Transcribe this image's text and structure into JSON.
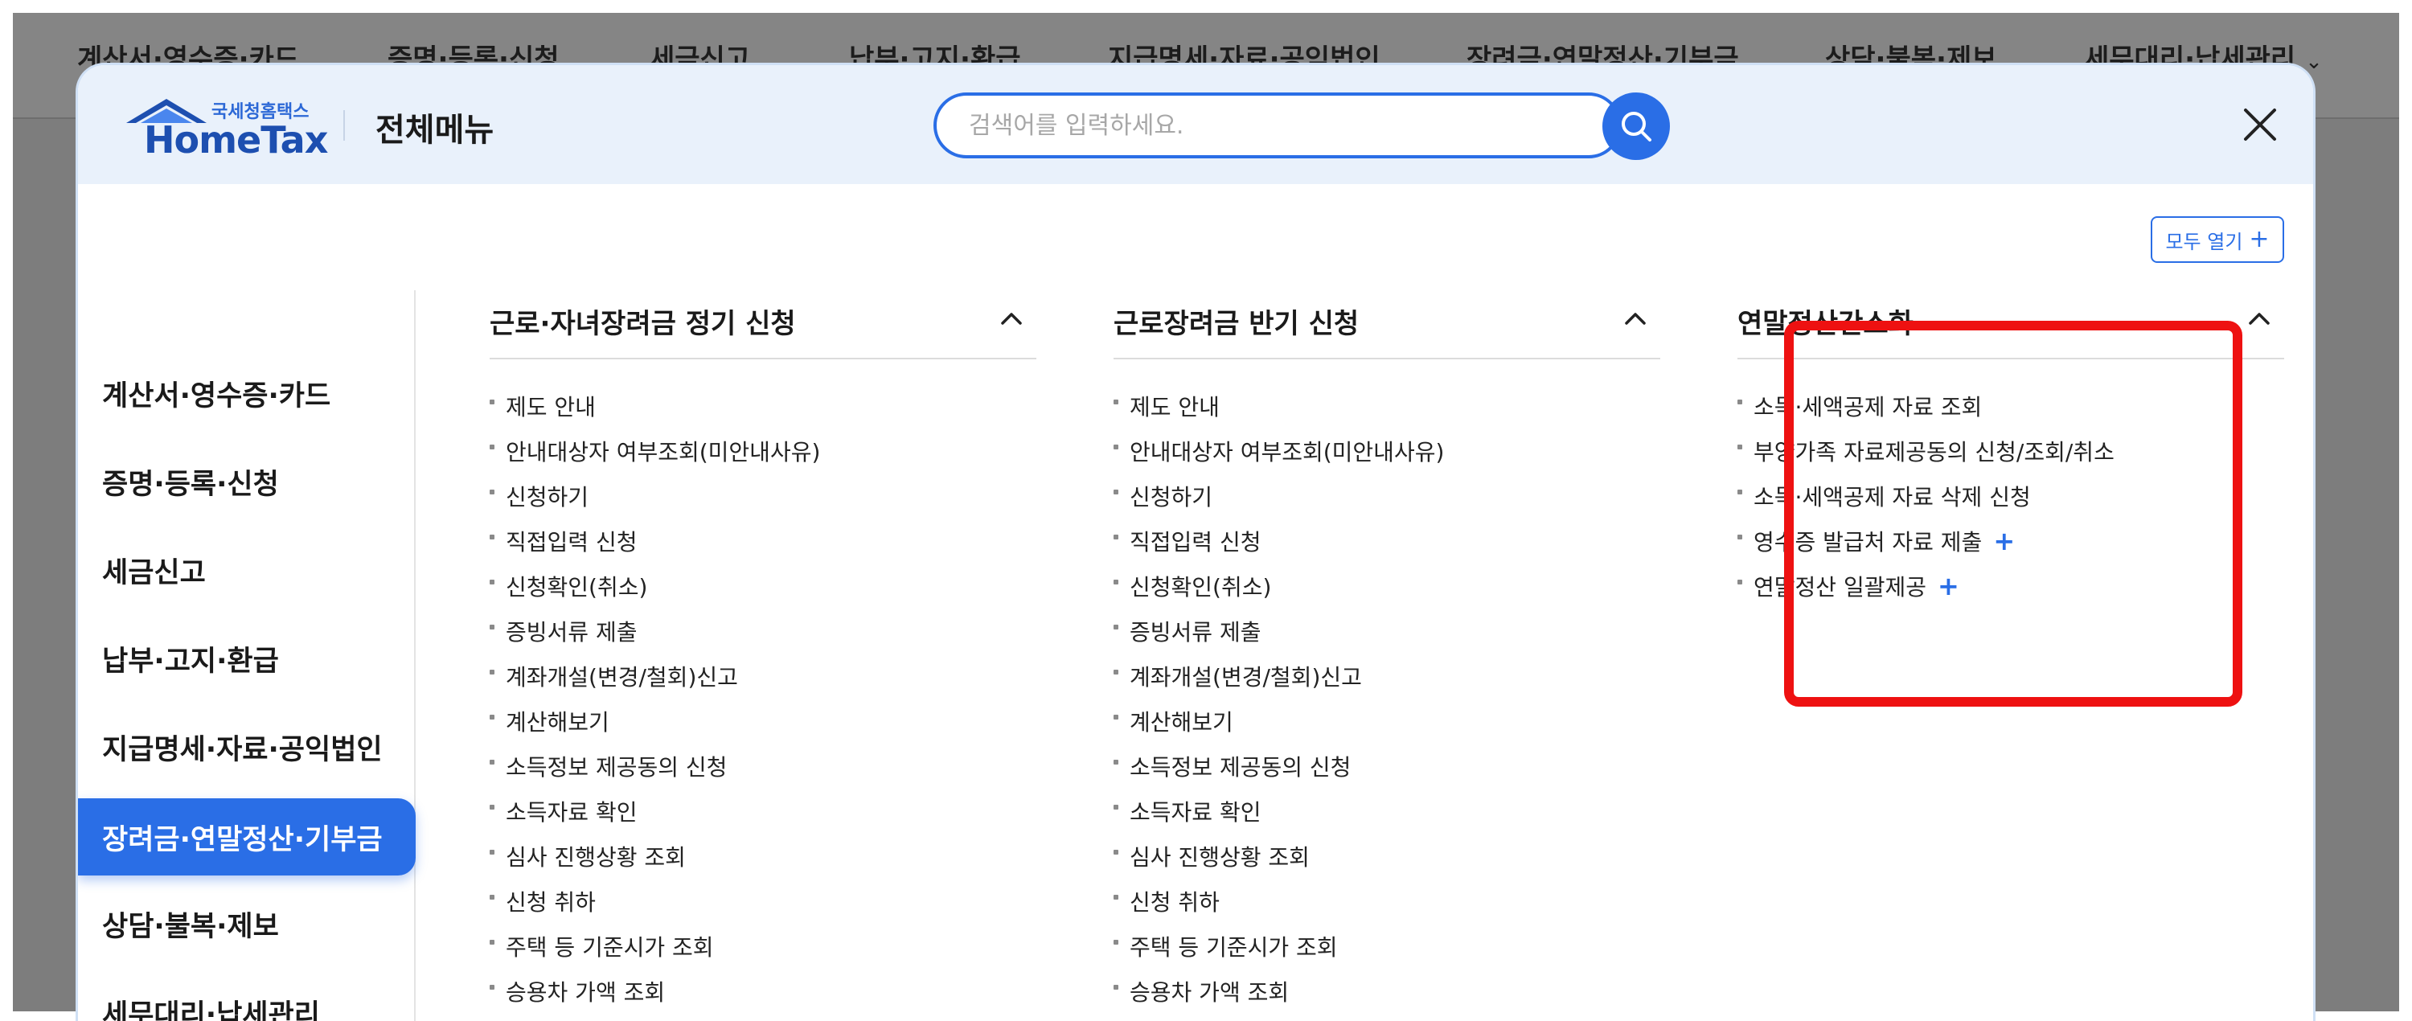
{
  "top_nav": {
    "items": [
      {
        "label": "계산서·영수증·카드"
      },
      {
        "label": "증명·등록·신청"
      },
      {
        "label": "세금신고"
      },
      {
        "label": "납부·고지·환급"
      },
      {
        "label": "지급명세·자료·공익법인"
      },
      {
        "label": "장려금·연말정산·기부금"
      },
      {
        "label": "상담·불복·제보"
      },
      {
        "label": "세무대리·납세관리"
      }
    ],
    "chevron": "⌄"
  },
  "modal": {
    "logo": {
      "small_text": "국세청홈택스",
      "big_text": "HomeTax"
    },
    "title": "전체메뉴",
    "search": {
      "placeholder": "검색어를 입력하세요."
    },
    "open_all_label": "모두 열기",
    "open_all_plus": "+"
  },
  "sidebar": {
    "items": [
      {
        "label": "계산서·영수증·카드"
      },
      {
        "label": "증명·등록·신청"
      },
      {
        "label": "세금신고"
      },
      {
        "label": "납부·고지·환급"
      },
      {
        "label": "지급명세·자료·공익법인"
      },
      {
        "label": "장려금·연말정산·기부금"
      },
      {
        "label": "상담·불복·제보"
      },
      {
        "label": "세무대리·납세관리"
      }
    ],
    "active_index": 5
  },
  "columns": [
    {
      "title": "근로·자녀장려금 정기 신청",
      "items": [
        {
          "label": "제도 안내"
        },
        {
          "label": "안내대상자 여부조회(미안내사유)"
        },
        {
          "label": "신청하기"
        },
        {
          "label": "직접입력 신청"
        },
        {
          "label": "신청확인(취소)"
        },
        {
          "label": "증빙서류 제출"
        },
        {
          "label": "계좌개설(변경/철회)신고"
        },
        {
          "label": "계산해보기"
        },
        {
          "label": "소득정보 제공동의 신청"
        },
        {
          "label": "소득자료 확인"
        },
        {
          "label": "심사 진행상황 조회"
        },
        {
          "label": "신청 취하"
        },
        {
          "label": "주택 등 기준시가 조회"
        },
        {
          "label": "승용차 가액 조회"
        }
      ]
    },
    {
      "title": "근로장려금 반기 신청",
      "items": [
        {
          "label": "제도 안내"
        },
        {
          "label": "안내대상자 여부조회(미안내사유)"
        },
        {
          "label": "신청하기"
        },
        {
          "label": "직접입력 신청"
        },
        {
          "label": "신청확인(취소)"
        },
        {
          "label": "증빙서류 제출"
        },
        {
          "label": "계좌개설(변경/철회)신고"
        },
        {
          "label": "계산해보기"
        },
        {
          "label": "소득정보 제공동의 신청"
        },
        {
          "label": "소득자료 확인"
        },
        {
          "label": "심사 진행상황 조회"
        },
        {
          "label": "신청 취하"
        },
        {
          "label": "주택 등 기준시가 조회"
        },
        {
          "label": "승용차 가액 조회"
        }
      ]
    },
    {
      "title": "연말정산간소화",
      "items": [
        {
          "label": "소득·세액공제 자료 조회"
        },
        {
          "label": "부양가족 자료제공동의 신청/조회/취소"
        },
        {
          "label": "소득·세액공제 자료 삭제 신청"
        },
        {
          "label": "영수증 발급처 자료 제출",
          "plus": "+"
        },
        {
          "label": "연말정산 일괄제공",
          "plus": "+"
        }
      ]
    }
  ],
  "colors": {
    "accent": "#2a6ee6",
    "header_bg": "#e9f1fb",
    "highlight": "#ee1111",
    "backdrop": "#7d7d7d"
  }
}
